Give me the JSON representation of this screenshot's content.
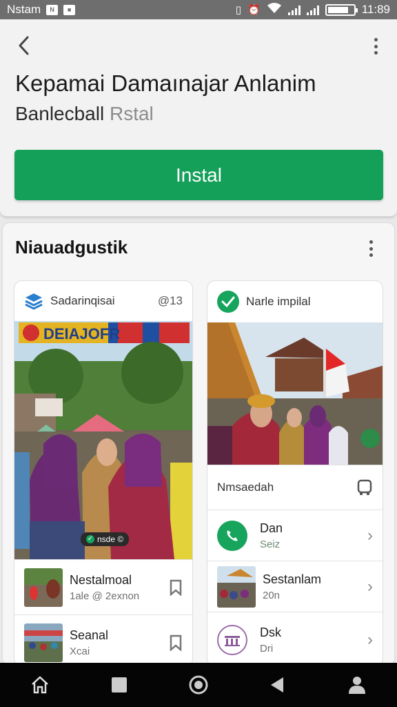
{
  "status_bar": {
    "carrier": "Nstam",
    "icon_left_1": "N",
    "time": "11:89",
    "battery_level": 0.8
  },
  "header": {
    "title": "Kepamai Damaınajar Anlanim",
    "subtitle_main": "Banlecball",
    "subtitle_muted": "Rstal",
    "install_label": "Instal",
    "colors": {
      "install": "#15a05a"
    }
  },
  "section": {
    "title": "Niauadgustik"
  },
  "left_card": {
    "header_label": "Sadarinqisai",
    "header_count": "@13",
    "photo_banner": "DEIAJOFR",
    "badge": "nsde ©",
    "rows": [
      {
        "title": "Nestalmoal",
        "subtitle": "1ale @ 2exnon"
      },
      {
        "title": "Seanal",
        "subtitle": "Xcai"
      }
    ]
  },
  "right_card": {
    "header_label": "Narle impilal",
    "subheader": "Nmsaedah",
    "rows": [
      {
        "title": "Dan",
        "subtitle": "Seiz",
        "icon": "phone-icon"
      },
      {
        "title": "Sestanlam",
        "subtitle": "20n",
        "icon": "thumbnail"
      },
      {
        "title": "Dsk",
        "subtitle": "Dri",
        "icon": "building-icon"
      }
    ]
  },
  "nav": [
    "home-icon",
    "square-icon",
    "circle-icon",
    "back-icon",
    "person-icon"
  ]
}
